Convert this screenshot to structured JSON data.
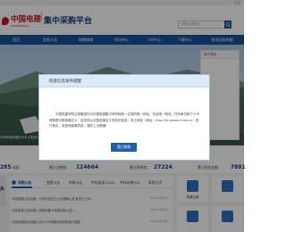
{
  "topbar": {
    "link": "中文"
  },
  "header": {
    "logo_cn": "中国电建",
    "logo_en": "POWERCHINA",
    "title": "集中采购平台",
    "search_placeholder": "请输入关键词"
  },
  "nav": {
    "items": [
      "首页",
      "信息公告",
      "电建商城",
      "资讯中心",
      "CA中心",
      "下载中心",
      "常识回复有题"
    ]
  },
  "banner": {
    "caption": "中国电建承建的冷水江电站2020年4月开工",
    "login_title": "用户登录"
  },
  "modal": {
    "title": "假冒信息发布提醒",
    "body": "中国电建采购交易集团作为中国电建集中采购和统一交易的唯一网站，仅此唯一网站，任何单位和个人不得假冒中国电建名义，若发现以中国电建名义发布的信息，请上网站（网址：http://ec.powerchina.cn）进行核实，或咨询客服热线，谨防上当受骗！",
    "button": "我已知晓"
  },
  "stats": [
    {
      "label": "标段",
      "value": "285"
    },
    {
      "label": "累计注册商：",
      "value": "124664"
    },
    {
      "label": "累计发布商：",
      "value": "27224"
    },
    {
      "label": "累计成交金额：",
      "value": "7881"
    }
  ],
  "lower": {
    "side_text": "头",
    "tabs": [
      "采购公告",
      "变更公告",
      "结果公告",
      "中标候选人公示",
      "中标结果公示",
      "采购方式"
    ],
    "rows": [
      {
        "text": "中国电建山东电建一公司开发区分公司国网山东省电力公司...",
        "date": "2024-06-06"
      },
      {
        "text": "中国电建江西电建公司超采集中采购招标公告...",
        "date": "2024-06-06"
      },
      {
        "text": "中国电建湖北电建公司2024年第四批采购询价结果...",
        "date": "2024-06-06"
      }
    ],
    "quick": [
      "快速注册",
      "",
      "",
      ""
    ]
  },
  "colors": {
    "nav": "#17509b",
    "brand_red": "#c4141d",
    "button": "#1e5fa8"
  }
}
